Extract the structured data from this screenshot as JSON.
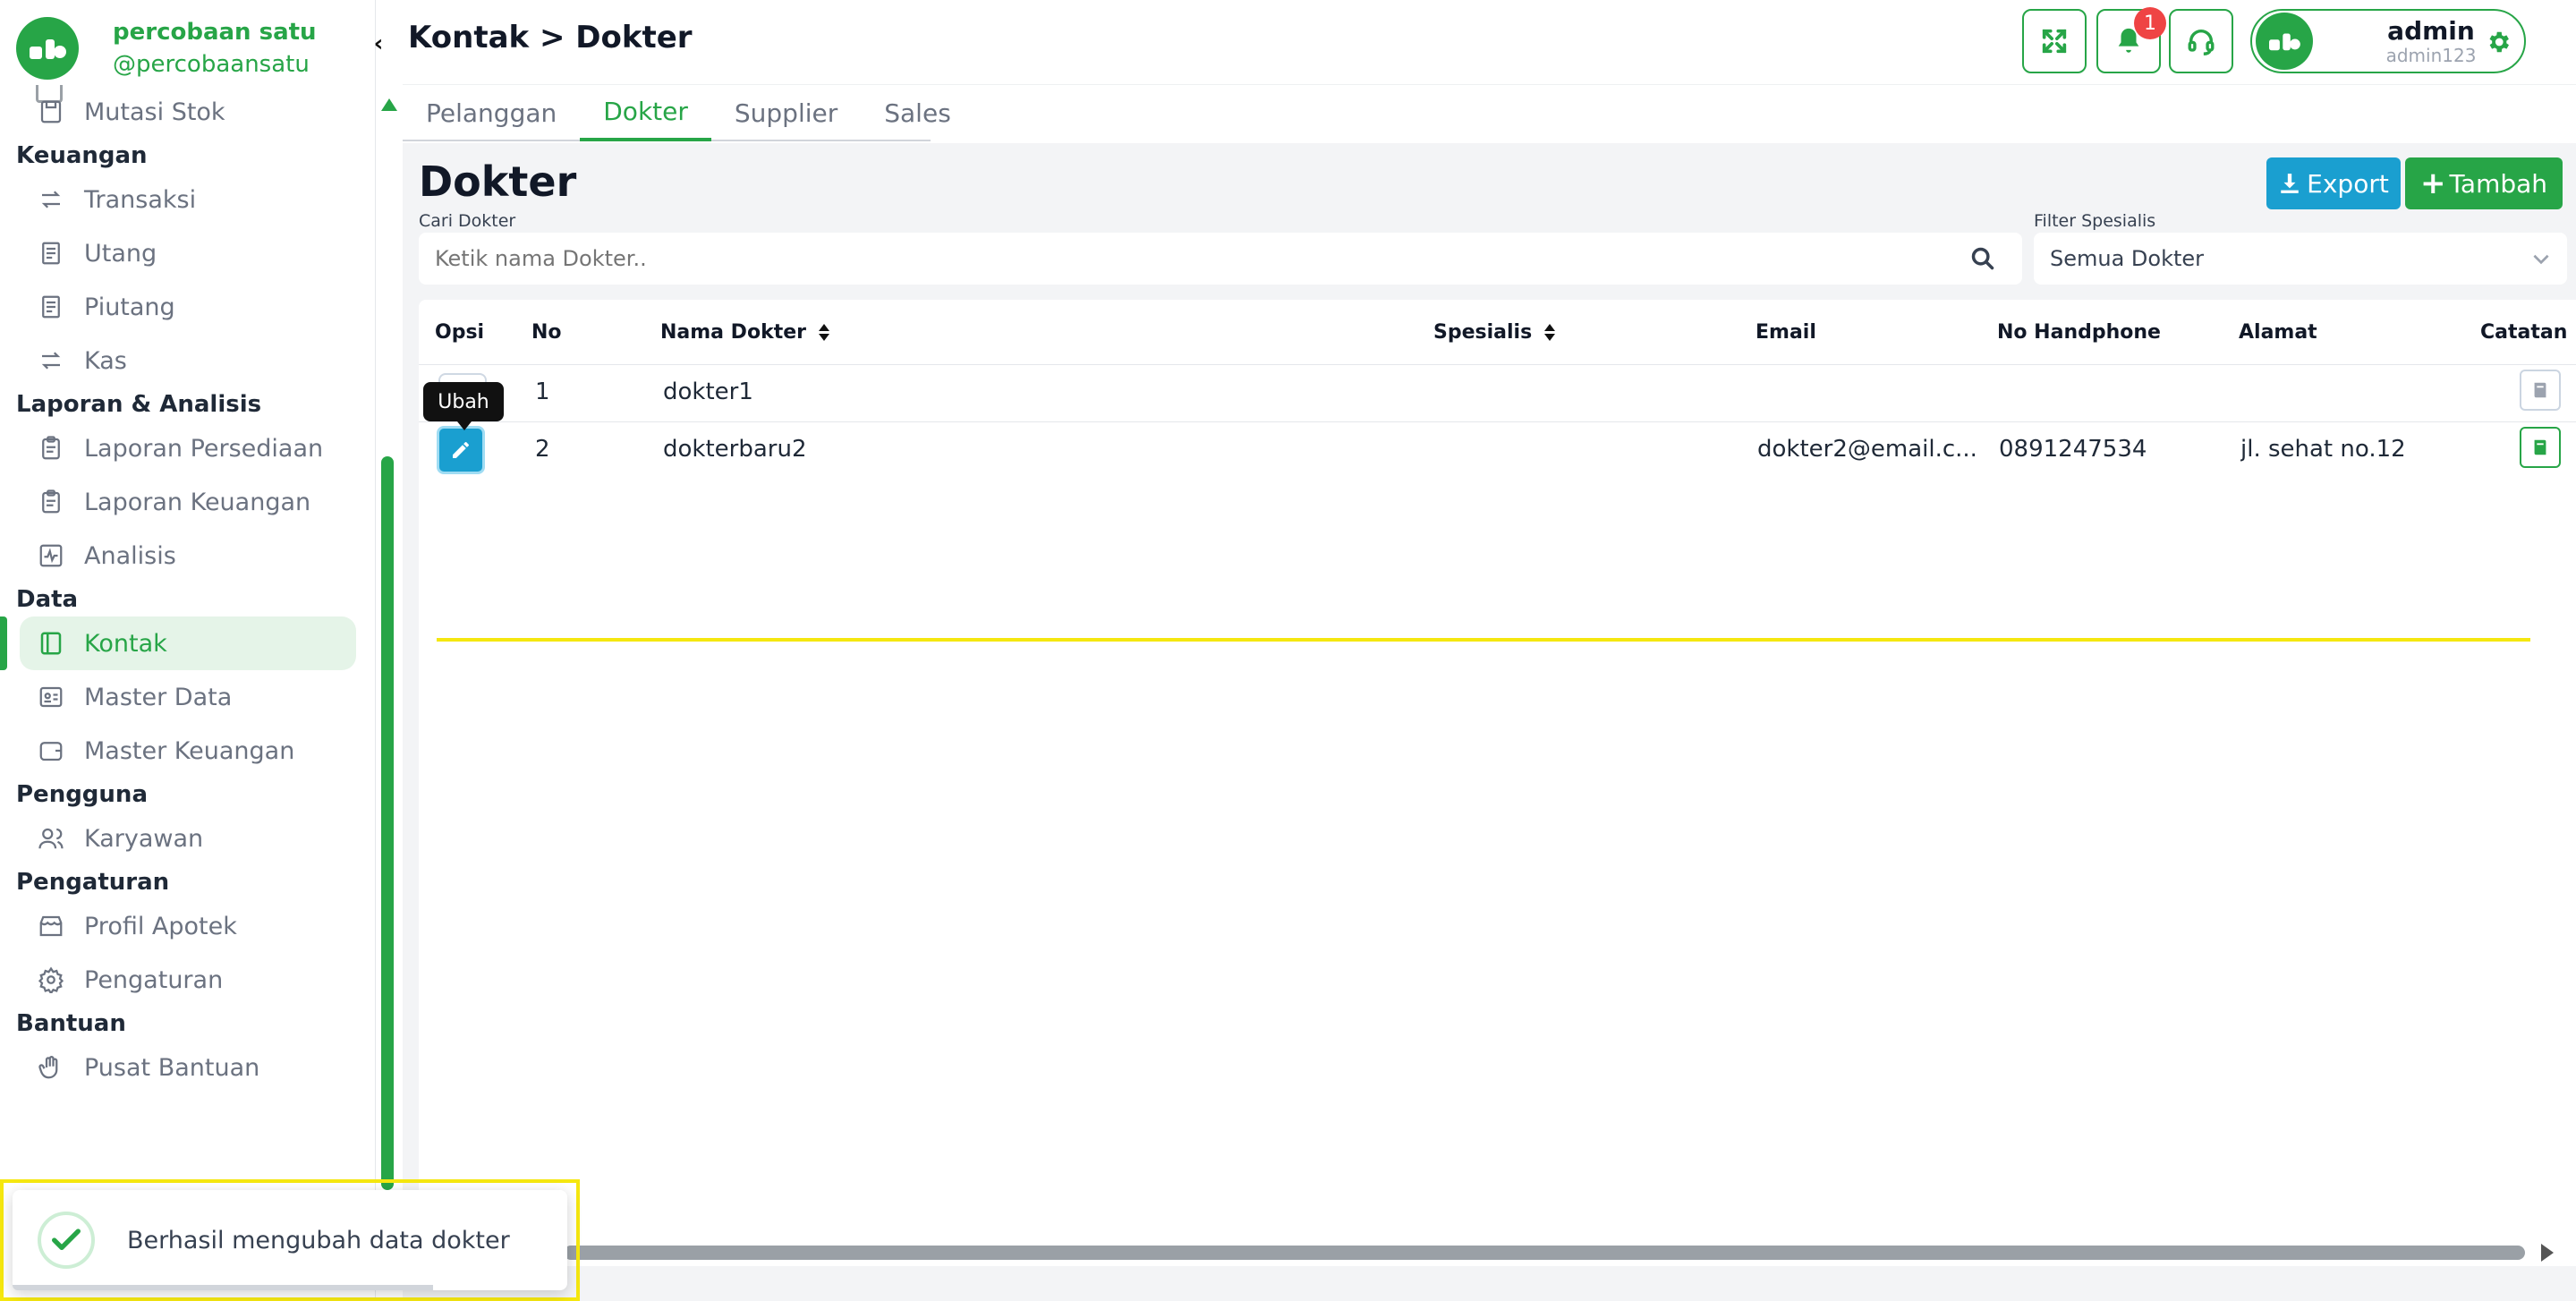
{
  "brand": {
    "name": "percobaan satu",
    "handle": "@percobaansatu"
  },
  "sidebar": {
    "sections": [
      {
        "title": "",
        "items": [
          {
            "label": "Mutasi Stok",
            "icon": "save-icon"
          }
        ]
      },
      {
        "title": "Keuangan",
        "items": [
          {
            "label": "Transaksi",
            "icon": "exchange-icon"
          },
          {
            "label": "Utang",
            "icon": "receipt-icon"
          },
          {
            "label": "Piutang",
            "icon": "receipt-icon"
          },
          {
            "label": "Kas",
            "icon": "exchange-icon"
          }
        ]
      },
      {
        "title": "Laporan & Analisis",
        "items": [
          {
            "label": "Laporan Persediaan",
            "icon": "clipboard-icon"
          },
          {
            "label": "Laporan Keuangan",
            "icon": "clipboard-icon"
          },
          {
            "label": "Analisis",
            "icon": "chart-pulse-icon"
          }
        ]
      },
      {
        "title": "Data",
        "items": [
          {
            "label": "Kontak",
            "icon": "contact-book-icon",
            "active": true
          },
          {
            "label": "Master Data",
            "icon": "id-card-icon"
          },
          {
            "label": "Master Keuangan",
            "icon": "wallet-icon"
          }
        ]
      },
      {
        "title": "Pengguna",
        "items": [
          {
            "label": "Karyawan",
            "icon": "users-icon"
          }
        ]
      },
      {
        "title": "Pengaturan",
        "items": [
          {
            "label": "Profil Apotek",
            "icon": "store-icon"
          },
          {
            "label": "Pengaturan",
            "icon": "gear-icon"
          }
        ]
      },
      {
        "title": "Bantuan",
        "items": [
          {
            "label": "Pusat Bantuan",
            "icon": "hand-icon"
          }
        ]
      }
    ]
  },
  "header": {
    "breadcrumb": "Kontak > Dokter",
    "notification_count": "1",
    "user": {
      "name": "admin",
      "username": "admin123"
    }
  },
  "tabs": [
    "Pelanggan",
    "Dokter",
    "Supplier",
    "Sales"
  ],
  "active_tab": "Dokter",
  "page": {
    "title": "Dokter",
    "export_label": "Export",
    "add_label": "Tambah",
    "search_label": "Cari Dokter",
    "search_placeholder": "Ketik nama Dokter..",
    "filter_label": "Filter Spesialis",
    "filter_value": "Semua Dokter"
  },
  "table": {
    "columns": [
      "Opsi",
      "No",
      "Nama Dokter",
      "Spesialis",
      "Email",
      "No Handphone",
      "Alamat",
      "Catatan"
    ],
    "rows": [
      {
        "no": "1",
        "nama": "dokter1",
        "spesialis": "",
        "email": "",
        "hp": "",
        "alamat": ""
      },
      {
        "no": "2",
        "nama": "dokterbaru2",
        "spesialis": "",
        "email": "dokter2@email.c...",
        "hp": "0891247534",
        "alamat": "jl. sehat no.12"
      }
    ]
  },
  "tooltip": "Ubah",
  "toast": {
    "message": "Berhasil mengubah data dokter"
  },
  "colors": {
    "primary": "#27a547",
    "info": "#1a9fd0",
    "danger": "#ef4444",
    "highlight": "#f5e70f"
  }
}
